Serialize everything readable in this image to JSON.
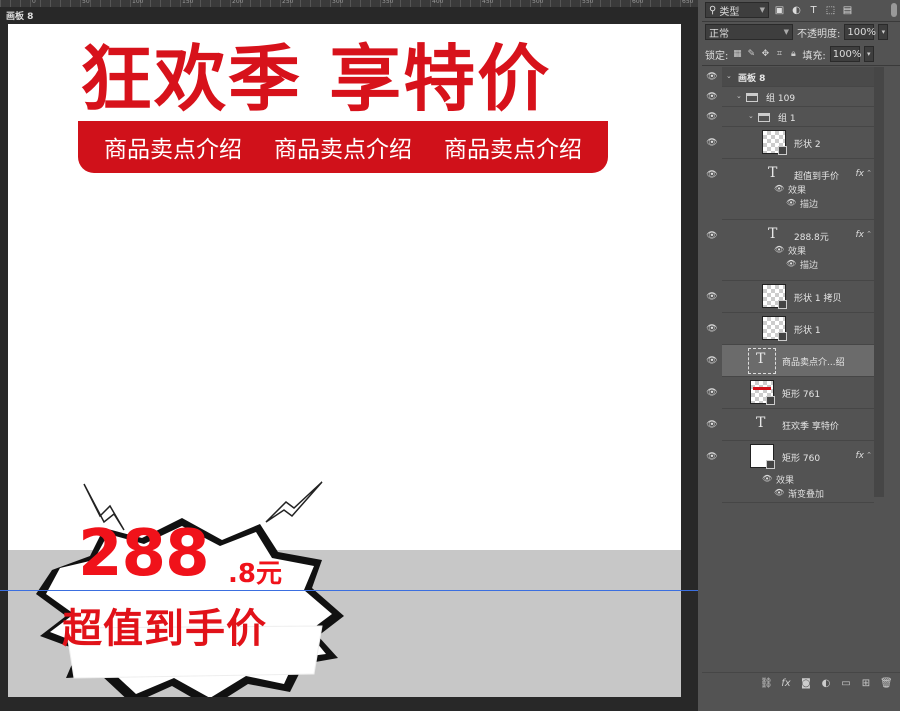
{
  "canvas": {
    "artboard_label": "画板 8",
    "ruler_labels": [
      "100",
      "50",
      "0",
      "50",
      "100",
      "150",
      "200",
      "250",
      "300",
      "350",
      "400",
      "450",
      "500",
      "550",
      "600",
      "650",
      "700",
      "750"
    ]
  },
  "artwork": {
    "headline": "狂欢季 享特价",
    "banner_items": [
      "商品卖点介绍",
      "商品卖点介绍",
      "商品卖点介绍"
    ],
    "price_big": "288",
    "price_small": ".8元",
    "price_label": "超值到手价",
    "colors": {
      "red": "#d7121b",
      "gray_strip": "#c7c7c7",
      "guide": "#3b6fe0"
    }
  },
  "panel": {
    "filter_kind": "类型",
    "blend_mode": "正常",
    "opacity_label": "不透明度:",
    "opacity_value": "100%",
    "lock_label": "锁定:",
    "fill_label": "填充:",
    "fill_value": "100%",
    "layers": {
      "artboard": "画板 8",
      "group109": "组 109",
      "group1": "组 1",
      "shape2": "形状 2",
      "text_price_label": "超值到手价",
      "effects1": "效果",
      "stroke1": "描边",
      "text_price": "288.8元",
      "effects2": "效果",
      "stroke2": "描边",
      "shape1_copy": "形状 1 拷贝",
      "shape1": "形状 1",
      "text_selling": "商品卖点介...绍",
      "rect761": "矩形 761",
      "text_headline": "狂欢季 享特价",
      "rect760": "矩形 760",
      "effects3": "效果",
      "gradient_overlay": "渐变叠加"
    },
    "fx": "fx"
  }
}
